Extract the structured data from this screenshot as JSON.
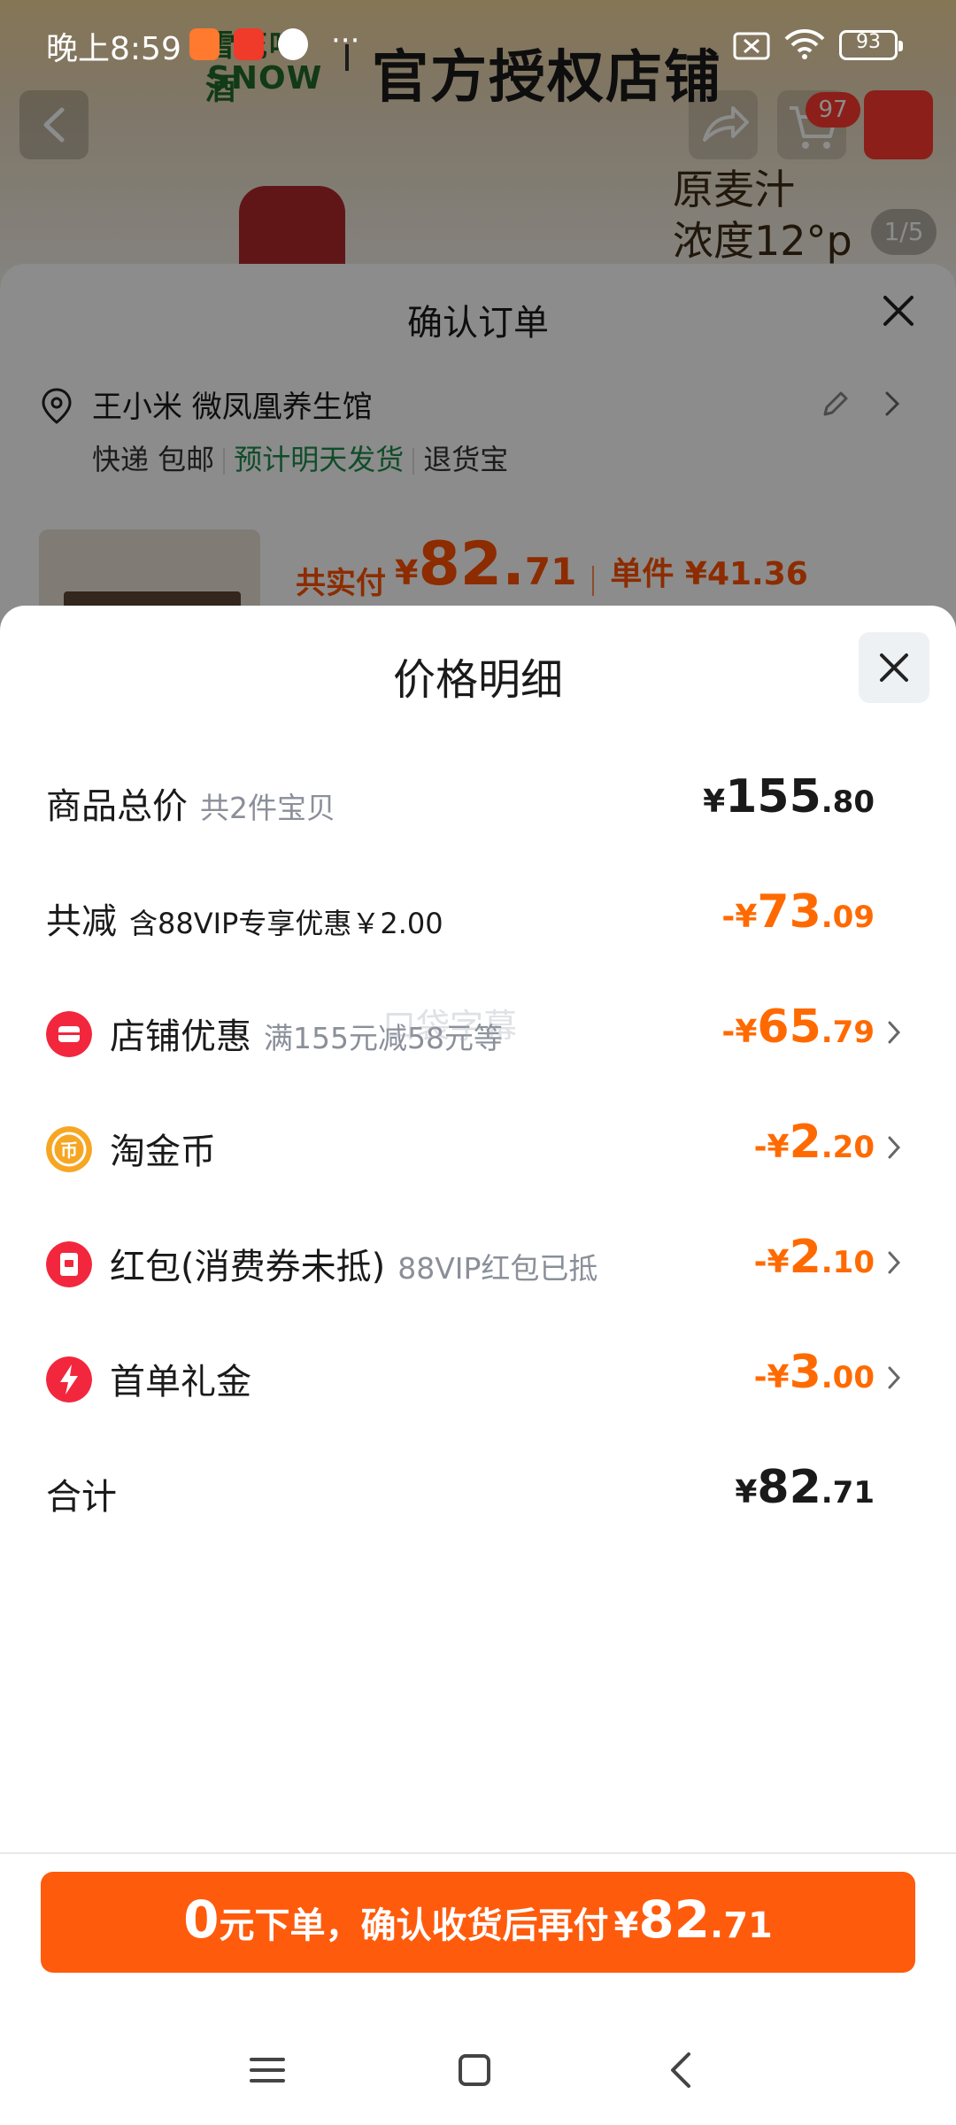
{
  "status_bar": {
    "time": "晚上8:59",
    "dots": "···",
    "battery": "93"
  },
  "background_page": {
    "brand_line1": "雪花啤酒",
    "brand_line2": "SNOW",
    "banner_title": "官方授权店铺",
    "cart_badge": "97",
    "desc_line1": "原麦汁",
    "desc_line2": "浓度12°p",
    "image_counter": "1/5"
  },
  "order_sheet": {
    "title": "确认订单",
    "address": "王小米 微凤凰养生馆",
    "shipping_method": "快递 包邮",
    "shipping_eta": "预计明天发货",
    "shipping_insurance": "退货宝",
    "total_label": "共实付",
    "total_currency": "¥",
    "total_int": "82.",
    "total_dec": "71",
    "unit_price": "单件 ¥41.36"
  },
  "price_detail": {
    "title": "价格明细",
    "rows": [
      {
        "label": "商品总价",
        "sub": "共2件宝贝",
        "cur": "¥",
        "int": "155",
        "dec": ".80"
      },
      {
        "label": "共减",
        "sub": "含88VIP专享优惠￥2.00",
        "cur": "-¥",
        "int": "73",
        "dec": ".09"
      },
      {
        "label": "店铺优惠",
        "sub": "满155元减58元等",
        "cur": "-¥",
        "int": "65",
        "dec": ".79"
      },
      {
        "label": "淘金币",
        "sub": "",
        "cur": "-¥",
        "int": "2",
        "dec": ".20"
      },
      {
        "label": "红包(消费券未抵)",
        "sub": "88VIP红包已抵",
        "cur": "-¥",
        "int": "2",
        "dec": ".10"
      },
      {
        "label": "首单礼金",
        "sub": "",
        "cur": "-¥",
        "int": "3",
        "dec": ".00"
      },
      {
        "label": "合计",
        "sub": "",
        "cur": "¥",
        "int": "82",
        "dec": ".71"
      }
    ],
    "watermark": "口袋字幕"
  },
  "cta": {
    "big": "0",
    "text": "元下单，确认收货后再付",
    "cur": "¥",
    "int": "82",
    "dec": ".71"
  },
  "colors": {
    "accent_orange": "#ff5b0d",
    "discount_orange": "#ff6a00",
    "green_eta": "#1f8a4c"
  },
  "icons": [
    "store-coupon-icon",
    "gold-coin-icon",
    "red-packet-icon",
    "flash-gift-icon"
  ]
}
